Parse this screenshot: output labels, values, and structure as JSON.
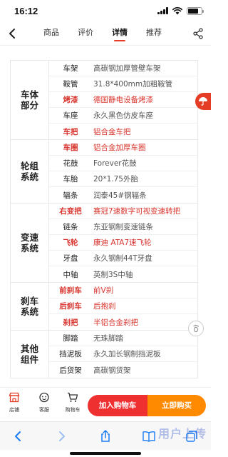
{
  "status_bar": {
    "time": "16:12"
  },
  "nav": {
    "tabs": [
      {
        "label": "商品"
      },
      {
        "label": "评价"
      },
      {
        "label": "详情"
      },
      {
        "label": "推荐"
      }
    ],
    "active_tab": "详情"
  },
  "spec_groups": [
    {
      "title": "车体部分",
      "rows": [
        {
          "name": "车架",
          "value": "高碳钢加厚管壁车架",
          "highlight": false
        },
        {
          "name": "鞍管",
          "value": "31.8*400mm加粗鞍管",
          "highlight": false
        },
        {
          "name": "烤漆",
          "value": "德国静电设备烤漆",
          "highlight": true
        },
        {
          "name": "车座",
          "value": "永久黑色仿皮车座",
          "highlight": false
        },
        {
          "name": "车把",
          "value": "铝合金车把",
          "highlight": true
        }
      ]
    },
    {
      "title": "轮组系统",
      "rows": [
        {
          "name": "车圈",
          "value": "铝合金加厚车圈",
          "highlight": true
        },
        {
          "name": "花鼓",
          "value": "Forever花鼓",
          "highlight": false
        },
        {
          "name": "车胎",
          "value": "20*1.75外胎",
          "highlight": false
        },
        {
          "name": "辐条",
          "value": "润泰45#钢辐条",
          "highlight": false
        }
      ]
    },
    {
      "title": "变速系统",
      "rows": [
        {
          "name": "右变把",
          "value": "赛冠7速数字可视变速转把",
          "highlight": true
        },
        {
          "name": "链条",
          "value": "东亚钢制变速链条",
          "highlight": false
        },
        {
          "name": "飞轮",
          "value": "康迪 ATA7速飞轮",
          "highlight": true
        },
        {
          "name": "牙盘",
          "value": "永久钢制44T牙盘",
          "highlight": false
        },
        {
          "name": "中轴",
          "value": "英制3S中轴",
          "highlight": false
        }
      ]
    },
    {
      "title": "刹车系统",
      "rows": [
        {
          "name": "前刹车",
          "value": "前V刹",
          "highlight": true
        },
        {
          "name": "后刹车",
          "value": "后抱刹",
          "highlight": true
        },
        {
          "name": "刹把",
          "value": "半铝合金刹把",
          "highlight": true
        }
      ]
    },
    {
      "title": "其他组件",
      "rows": [
        {
          "name": "脚踏",
          "value": "无珠脚踏",
          "highlight": false
        },
        {
          "name": "挡泥板",
          "value": "永久加长钢制挡泥板",
          "highlight": false
        },
        {
          "name": "后货架",
          "value": "高碳钢货架",
          "highlight": false
        }
      ]
    }
  ],
  "action_bar": {
    "store_label": "店铺",
    "service_label": "客服",
    "cart_label": "购物车",
    "add_to_cart_label": "加入购物车",
    "buy_now_label": "立即购买"
  },
  "watermark": "用户上传",
  "colors": {
    "accent": "#e43c25",
    "highlight_text": "#d8332c",
    "buy_button": "#ff8a00",
    "cart_button": "#ef3030"
  },
  "icons": [
    "back-arrow-icon",
    "share-icon",
    "store-icon",
    "service-icon",
    "cart-icon",
    "back-icon",
    "forward-icon",
    "share-icon",
    "bookmarks-icon",
    "tabs-icon"
  ]
}
